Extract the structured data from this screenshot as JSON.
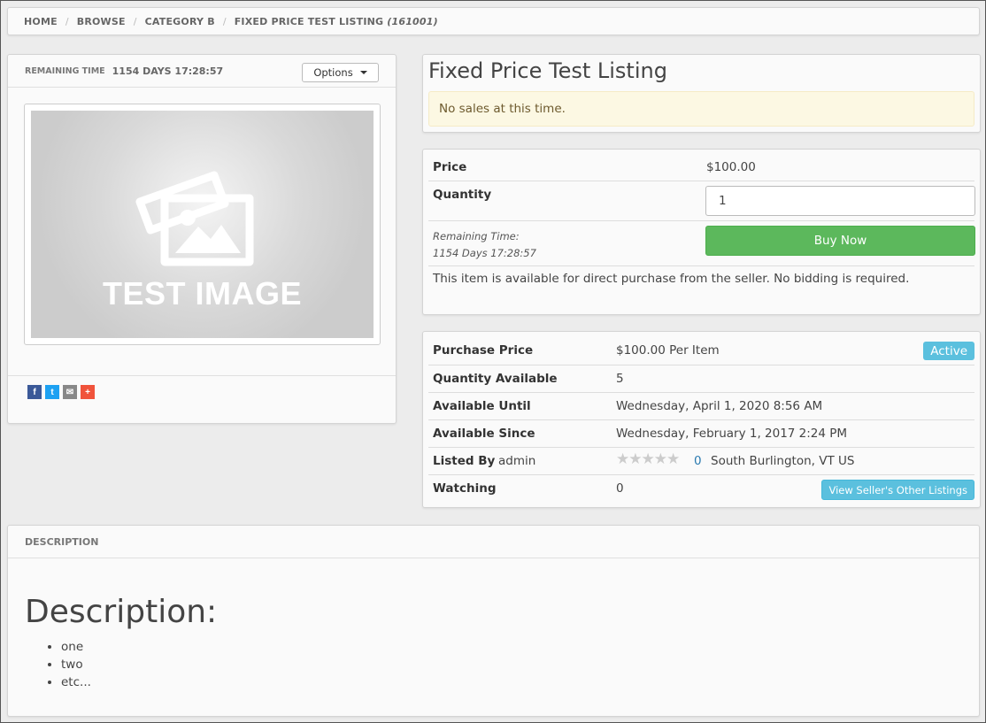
{
  "breadcrumb": {
    "items": [
      "HOME",
      "BROWSE",
      "CATEGORY B",
      "FIXED PRICE TEST LISTING"
    ],
    "listing_id": "(161001)"
  },
  "image_panel": {
    "remaining_label": "REMAINING TIME",
    "remaining_value": "1154 DAYS 17:28:57",
    "options_label": "Options",
    "image_text": "TEST IMAGE",
    "share": [
      {
        "name": "facebook",
        "glyph": "f",
        "color": "#3b5998"
      },
      {
        "name": "twitter",
        "glyph": "t",
        "color": "#1da1f2"
      },
      {
        "name": "email",
        "glyph": "✉",
        "color": "#888888"
      },
      {
        "name": "more",
        "glyph": "+",
        "color": "#f0533b"
      }
    ]
  },
  "listing": {
    "title": "Fixed Price Test Listing",
    "no_sales": "No sales at this time."
  },
  "purchase": {
    "price_label": "Price",
    "price_value": "$100.00",
    "quantity_label": "Quantity",
    "quantity_value": "1",
    "remaining_label": "Remaining Time:",
    "remaining_value": "1154 Days 17:28:57",
    "buy_now": "Buy Now",
    "note": "This item is available for direct purchase from the seller. No bidding is required."
  },
  "details": {
    "purchase_price_label": "Purchase Price",
    "purchase_price_value": "$100.00 Per Item",
    "status_badge": "Active",
    "qty_available_label": "Quantity Available",
    "qty_available_value": "5",
    "available_until_label": "Available Until",
    "available_until_value": "Wednesday, April 1, 2020 8:56 AM",
    "available_since_label": "Available Since",
    "available_since_value": "Wednesday, February 1, 2017 2:24 PM",
    "listed_by_label": "Listed By",
    "listed_by_value": "admin",
    "rating_count": "0",
    "location": "South Burlington, VT US",
    "watching_label": "Watching",
    "watching_value": "0",
    "other_listings": "View Seller's Other Listings"
  },
  "description": {
    "header": "DESCRIPTION",
    "heading": "Description:",
    "items": [
      "one",
      "two",
      "etc..."
    ]
  },
  "colors": {
    "buy_now": "#5cb85c",
    "info": "#5bc0de",
    "warning_bg": "#fcf8e3"
  }
}
